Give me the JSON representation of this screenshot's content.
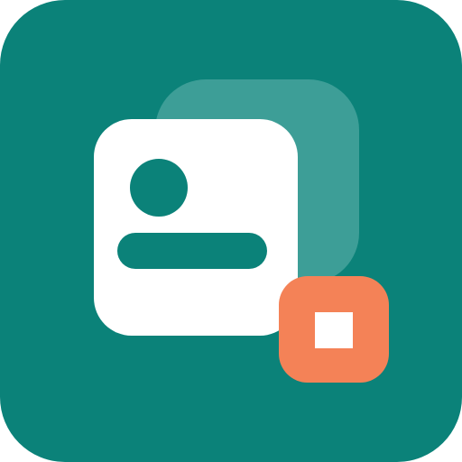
{
  "icon": {
    "name": "profile-card-stop-app-icon",
    "colors": {
      "background": "#0b8279",
      "back_card": "#3d9e97",
      "front_card": "#ffffff",
      "accent_teal": "#0b8279",
      "badge": "#f48257",
      "badge_symbol": "#ffffff"
    },
    "symbols": {
      "card": "contact-card-icon",
      "badge": "stop-icon"
    }
  }
}
